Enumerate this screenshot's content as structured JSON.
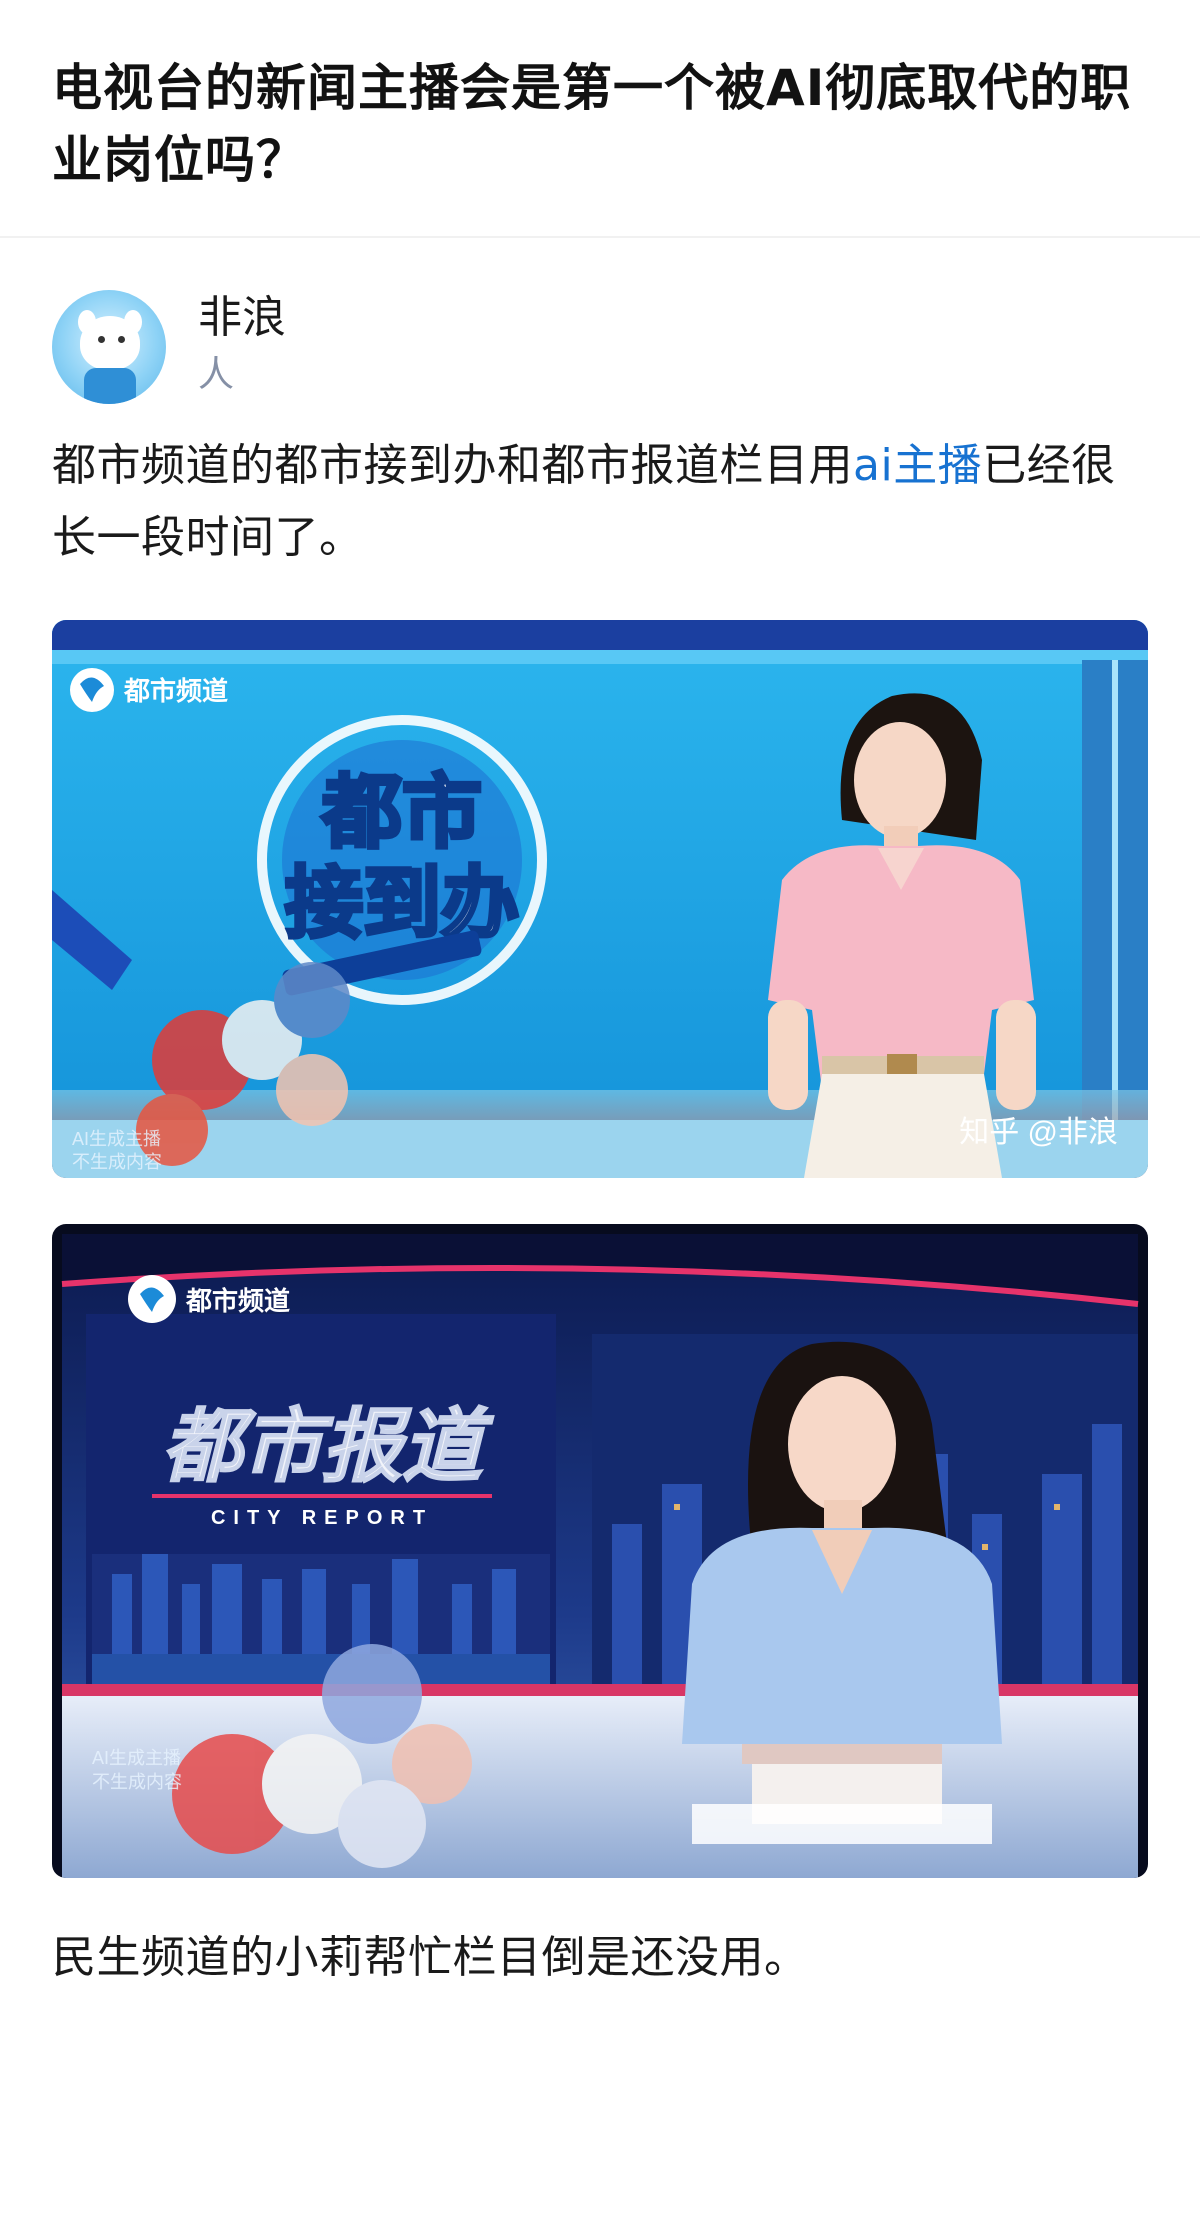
{
  "question": {
    "title": "电视台的新闻主播会是第一个被AI彻底取代的职业岗位吗？"
  },
  "author": {
    "name": "非浪",
    "bio": "人"
  },
  "paragraph1": {
    "before": "都市频道的都市接到办和都市报道栏目用",
    "keyword": "ai主播",
    "after": "已经很长一段时间了。"
  },
  "image1": {
    "channel_logo": "都市频道",
    "show_title_line1": "都市",
    "show_title_line2": "接到办",
    "ai_notice_line1": "AI生成主播",
    "ai_notice_line2": "不生成内容",
    "watermark": "知乎 @非浪"
  },
  "image2": {
    "channel_logo": "都市频道",
    "show_title": "都市报道",
    "show_subtitle": "CITY REPORT",
    "ai_notice_line1": "AI生成主播",
    "ai_notice_line2": "不生成内容"
  },
  "paragraph2": {
    "text": "民生频道的小莉帮忙栏目倒是还没用。"
  }
}
